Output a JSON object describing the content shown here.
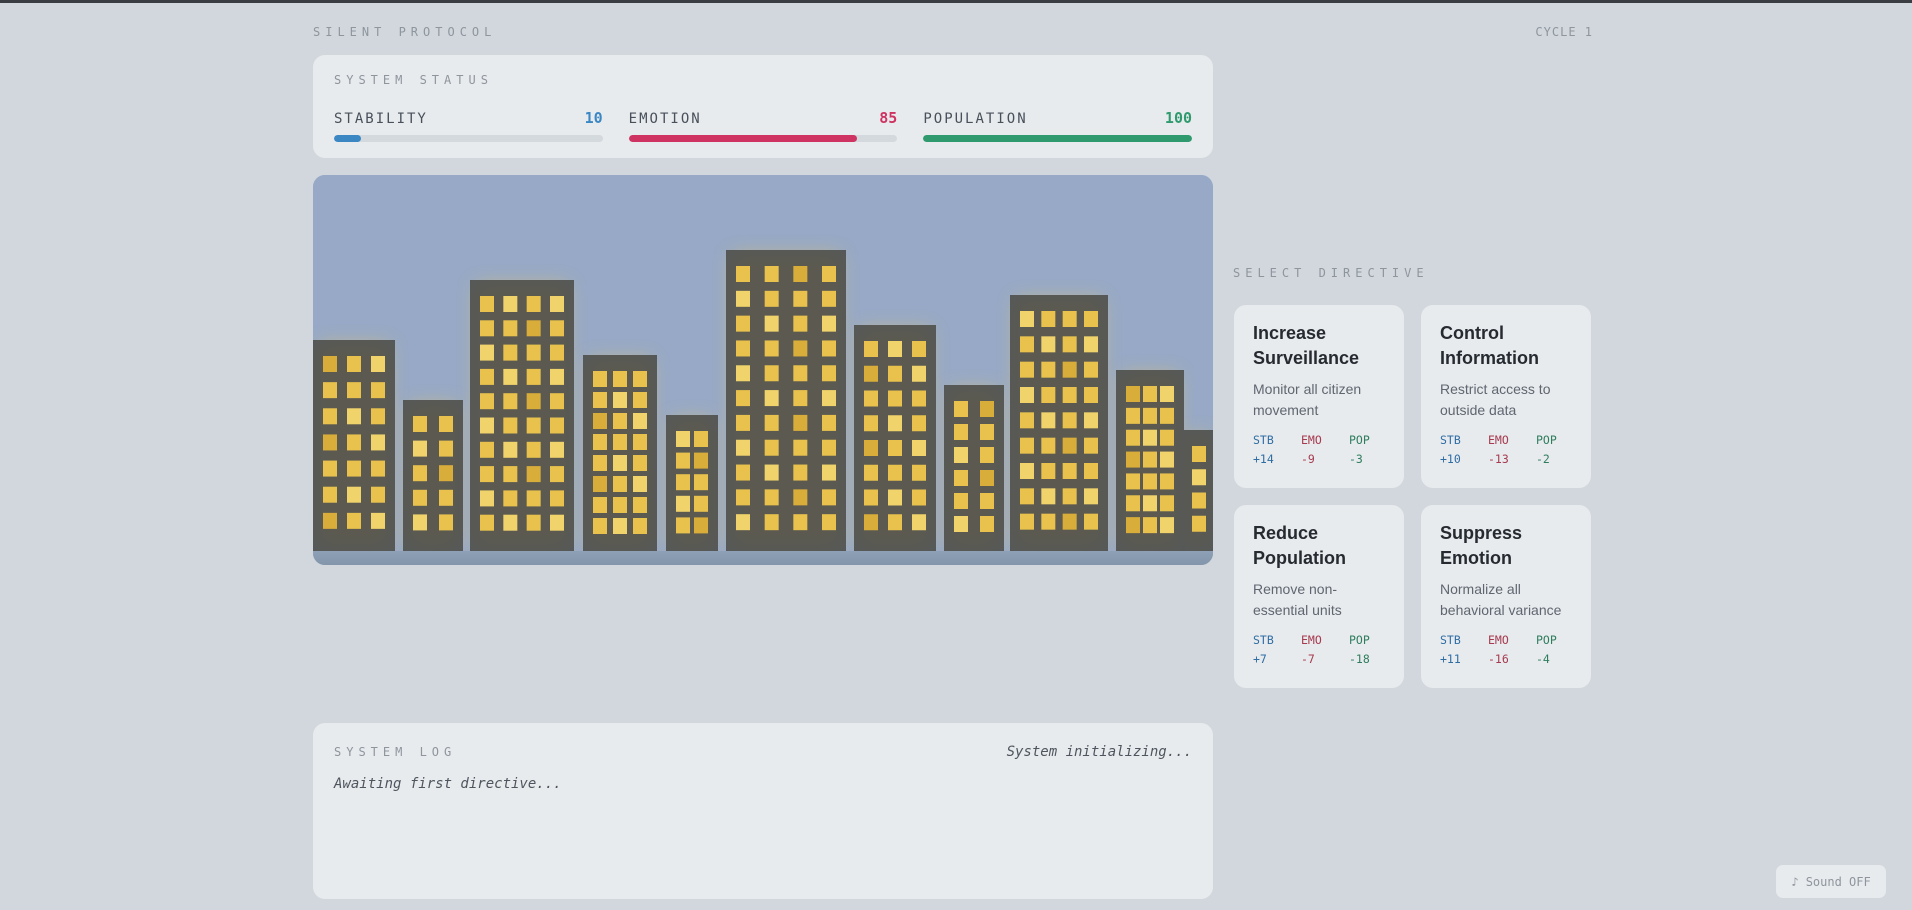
{
  "header": {
    "title": "SILENT PROTOCOL",
    "cycle": "CYCLE 1"
  },
  "status": {
    "label": "SYSTEM STATUS",
    "meters": [
      {
        "name": "STABILITY",
        "value": "10",
        "fraction": 0.1,
        "color": "#3a87c4"
      },
      {
        "name": "EMOTION",
        "value": "85",
        "fraction": 0.85,
        "color": "#cf3361"
      },
      {
        "name": "POPULATION",
        "value": "100",
        "fraction": 1.0,
        "color": "#2f9a6e"
      }
    ]
  },
  "directives": {
    "label": "SELECT DIRECTIVE",
    "cards": [
      {
        "title": "Increase Surveillance",
        "desc": "Monitor all citizen movement",
        "stb": {
          "label": "STB",
          "value": "+14"
        },
        "emo": {
          "label": "EMO",
          "value": "-9"
        },
        "pop": {
          "label": "POP",
          "value": "-3"
        }
      },
      {
        "title": "Control Information",
        "desc": "Restrict access to outside data",
        "stb": {
          "label": "STB",
          "value": "+10"
        },
        "emo": {
          "label": "EMO",
          "value": "-13"
        },
        "pop": {
          "label": "POP",
          "value": "-2"
        }
      },
      {
        "title": "Reduce Population",
        "desc": "Remove non-essential units",
        "stb": {
          "label": "STB",
          "value": "+7"
        },
        "emo": {
          "label": "EMO",
          "value": "-7"
        },
        "pop": {
          "label": "POP",
          "value": "-18"
        }
      },
      {
        "title": "Suppress Emotion",
        "desc": "Normalize all behavioral variance",
        "stb": {
          "label": "STB",
          "value": "+11"
        },
        "emo": {
          "label": "EMO",
          "value": "-16"
        },
        "pop": {
          "label": "POP",
          "value": "-4"
        }
      }
    ]
  },
  "log": {
    "label": "SYSTEM LOG",
    "status": "System initializing...",
    "line": "Awaiting first directive..."
  },
  "sound": {
    "label": "♪ Sound OFF"
  },
  "colors": {
    "sky": "#97a9c6",
    "building": "#4a4a45",
    "window": "#e8c24d",
    "glow": "#e6c25a"
  }
}
